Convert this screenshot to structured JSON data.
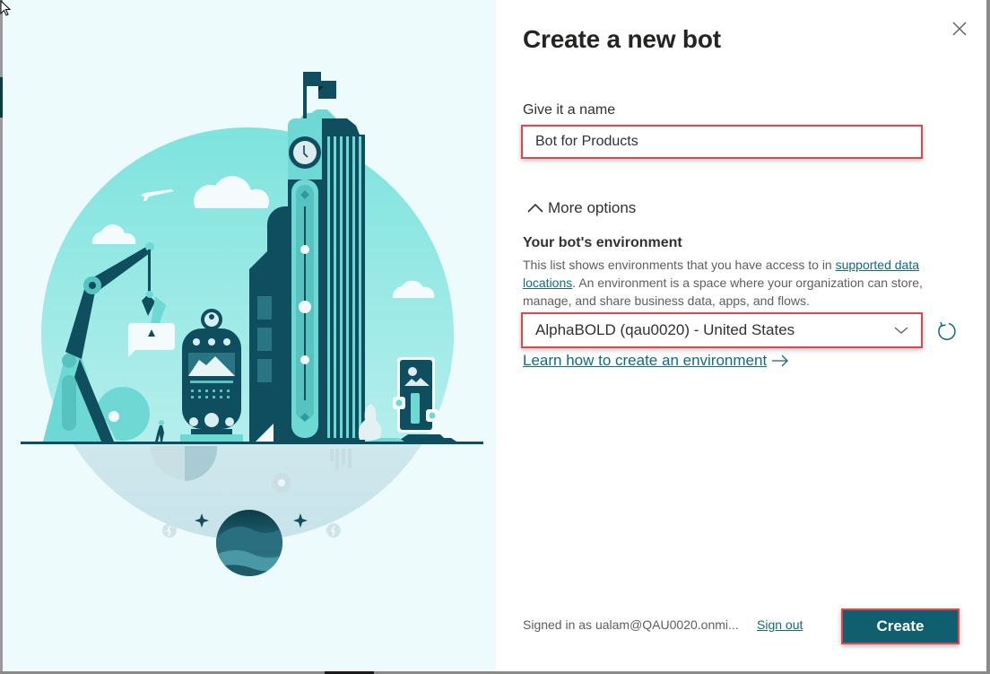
{
  "dialog": {
    "title": "Create a new bot",
    "close_icon": "close-icon"
  },
  "name_field": {
    "label": "Give it a name",
    "value": "Bot for Products"
  },
  "more_options": {
    "label": "More options",
    "icon": "chevron-up-icon",
    "expanded": true
  },
  "environment": {
    "heading": "Your bot's environment",
    "desc_before_link": "This list shows environments that you have access to in ",
    "desc_link": "supported data locations",
    "desc_after_link": ". An environment is a space where your organization can store, manage, and share business data, apps, and flows.",
    "selected": "AlphaBOLD (qau0020) - United States",
    "dropdown_icon": "chevron-down-icon",
    "refresh_icon": "refresh-icon",
    "learn_link": "Learn how to create an environment",
    "learn_icon": "arrow-right-icon"
  },
  "footer": {
    "signed_in": "Signed in as ualam@QAU0020.onmi...",
    "sign_out": "Sign out",
    "create_label": "Create"
  },
  "colors": {
    "primary": "#0f5f70",
    "link": "#0f6b80",
    "highlight": "#e0474c",
    "art_bg": "#eefbfd",
    "art_teal": "#7fe0dc",
    "art_dark": "#0e4e5e"
  }
}
